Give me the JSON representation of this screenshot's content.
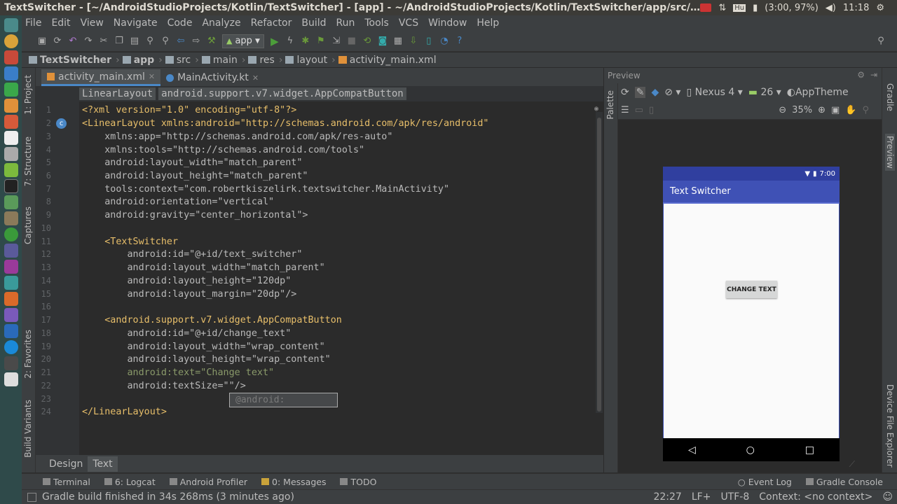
{
  "os_bar": {
    "title": "TextSwitcher - [~/AndroidStudioProjects/Kotlin/TextSwitcher] - [app] - ~/AndroidStudioProjects/Kotlin/TextSwitcher/app/src/main/res/layout/activity_main.xml",
    "battery": "(3:00, 97%)",
    "time": "11:18"
  },
  "menu": [
    "File",
    "Edit",
    "View",
    "Navigate",
    "Code",
    "Analyze",
    "Refactor",
    "Build",
    "Run",
    "Tools",
    "VCS",
    "Window",
    "Help"
  ],
  "toolbar": {
    "run_config": "app"
  },
  "breadcrumbs": [
    "TextSwitcher",
    "app",
    "src",
    "main",
    "res",
    "layout",
    "activity_main.xml"
  ],
  "left_tools": [
    "1: Project",
    "7: Structure",
    "Captures",
    "2: Favorites",
    "Build Variants"
  ],
  "editor_tabs": [
    {
      "label": "activity_main.xml"
    },
    {
      "label": "MainActivity.kt"
    }
  ],
  "xml_crumbs": [
    "LinearLayout",
    "android.support.v7.widget.AppCompatButton"
  ],
  "line_numbers": [
    "1",
    "2",
    "3",
    "4",
    "5",
    "6",
    "7",
    "8",
    "9",
    "10",
    "11",
    "12",
    "13",
    "14",
    "15",
    "16",
    "17",
    "18",
    "19",
    "20",
    "21",
    "22",
    "23",
    "24"
  ],
  "code_lines": [
    "<?xml version=\"1.0\" encoding=\"utf-8\"?>",
    "<LinearLayout xmlns:android=\"http://schemas.android.com/apk/res/android\"",
    "    xmlns:app=\"http://schemas.android.com/apk/res-auto\"",
    "    xmlns:tools=\"http://schemas.android.com/tools\"",
    "    android:layout_width=\"match_parent\"",
    "    android:layout_height=\"match_parent\"",
    "    tools:context=\"com.robertkiszelirk.textswitcher.MainActivity\"",
    "    android:orientation=\"vertical\"",
    "    android:gravity=\"center_horizontal\">",
    "",
    "    <TextSwitcher",
    "        android:id=\"@+id/text_switcher\"",
    "        android:layout_width=\"match_parent\"",
    "        android:layout_height=\"120dp\"",
    "        android:layout_margin=\"20dp\"/>",
    "",
    "    <android.support.v7.widget.AppCompatButton",
    "        android:id=\"@+id/change_text\"",
    "        android:layout_width=\"wrap_content\"",
    "        android:layout_height=\"wrap_content\"",
    "        android:text=\"Change text\"",
    "        android:textSize=\"\"/>",
    "",
    "</LinearLayout>"
  ],
  "autocomplete": "@android:",
  "design_tabs": [
    {
      "label": "Design"
    },
    {
      "label": "Text"
    }
  ],
  "preview": {
    "header": "Preview",
    "palette_label": "Palette",
    "device": "Nexus 4",
    "api": "26",
    "theme": "AppTheme",
    "zoom": "35%",
    "phone_time": "7:00",
    "app_title": "Text Switcher",
    "button_label": "CHANGE TEXT"
  },
  "right_tools": [
    "Gradle",
    "Preview",
    "Device File Explorer"
  ],
  "bottom_tools": [
    "Terminal",
    "6: Logcat",
    "Android Profiler",
    "0: Messages",
    "TODO",
    "Event Log",
    "Gradle Console"
  ],
  "status": {
    "message": "Gradle build finished in 34s 268ms (3 minutes ago)",
    "position": "22:27",
    "line_sep": "LF+",
    "encoding": "UTF-8",
    "context": "Context: <no context>"
  },
  "colors": {
    "accent": "#4a88c7",
    "app_primary": "#3f51b5",
    "app_dark": "#303f9f",
    "background": "#2b2b2b"
  }
}
